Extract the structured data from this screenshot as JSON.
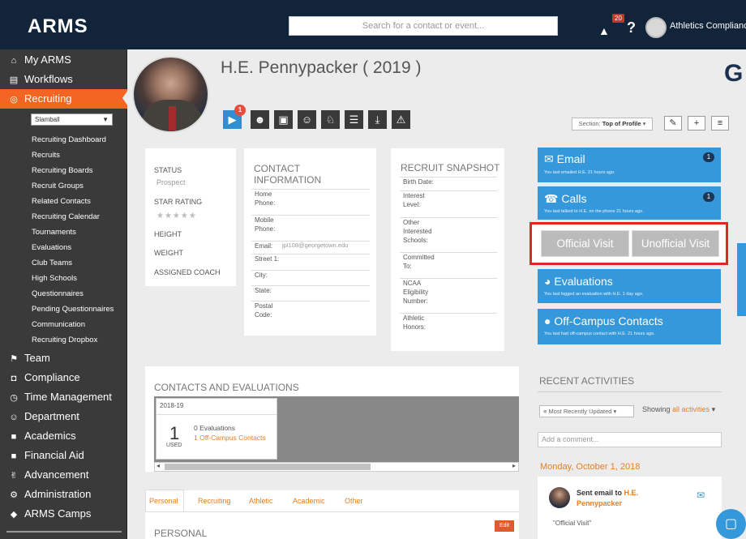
{
  "topbar": {
    "logo": "ARMS",
    "search_placeholder": "Search for a contact or event...",
    "notification_count": "20",
    "help": "?",
    "user_name": "Athletics Compliance"
  },
  "sidebar": {
    "items": [
      {
        "label": "My ARMS",
        "icon": "home-icon"
      },
      {
        "label": "Workflows",
        "icon": "clipboard-icon"
      },
      {
        "label": "Recruiting",
        "icon": "target-icon"
      },
      {
        "label": "Team",
        "icon": "flag-icon"
      },
      {
        "label": "Compliance",
        "icon": "shield-icon"
      },
      {
        "label": "Time Management",
        "icon": "clock-icon"
      },
      {
        "label": "Department",
        "icon": "group-icon"
      },
      {
        "label": "Academics",
        "icon": "book-icon"
      },
      {
        "label": "Financial Aid",
        "icon": "book-icon"
      },
      {
        "label": "Advancement",
        "icon": "handshake-icon"
      },
      {
        "label": "Administration",
        "icon": "gear-icon"
      },
      {
        "label": "ARMS Camps",
        "icon": "diamond-icon"
      }
    ],
    "sport_select": "Slamball",
    "subitems": [
      "Recruiting Dashboard",
      "Recruits",
      "Recruiting Boards",
      "Recruit Groups",
      "Related Contacts",
      "Recruiting Calendar",
      "Tournaments",
      "Evaluations",
      "Club Teams",
      "High Schools",
      "Questionnaires",
      "Pending Questionnaires",
      "Communication",
      "Recruiting Dropbox"
    ]
  },
  "profile": {
    "name": "H.E. Pennypacker ( 2019 )",
    "school_logo": "G",
    "icon_badge": "1",
    "action_icons": [
      "play-icon",
      "group-icon",
      "id-card-icon",
      "person-icon",
      "trophy-icon",
      "document-icon",
      "download-icon",
      "warning-icon"
    ],
    "section_label": "Section:",
    "section_value": "Top of Profile",
    "tool_buttons": [
      "edit-icon",
      "+",
      "≡"
    ]
  },
  "status_card": {
    "status_label": "STATUS",
    "status_value": "Prospect",
    "star_label": "STAR RATING",
    "stars": "★★★★★",
    "height_label": "HEIGHT",
    "weight_label": "WEIGHT",
    "coach_label": "ASSIGNED COACH"
  },
  "contact_info": {
    "title_1": "CONTACT",
    "title_2": "INFORMATION",
    "fields": [
      {
        "label_1": "Home",
        "label_2": "Phone:",
        "value": ""
      },
      {
        "label_1": "Mobile",
        "label_2": "Phone:",
        "value": ""
      },
      {
        "label_1": "Email:",
        "label_2": "",
        "value": "jpl108@georgetown.edu"
      },
      {
        "label_1": "Street 1:",
        "label_2": "",
        "value": ""
      },
      {
        "label_1": "City:",
        "label_2": "",
        "value": ""
      },
      {
        "label_1": "State:",
        "label_2": "",
        "value": ""
      },
      {
        "label_1": "Postal",
        "label_2": "Code:",
        "value": ""
      }
    ]
  },
  "snapshot": {
    "title": "RECRUIT SNAPSHOT",
    "fields": [
      "Birth Date:",
      "Interest\nLevel:",
      "Other\nInterested\nSchools:",
      "Committed\nTo:",
      "NCAA\nEligibility\nNumber:",
      "Athletic\nHonors:"
    ]
  },
  "comm_panels": {
    "email_title": "Email",
    "email_sub": "You last emailed H.E. 21 hours ago.",
    "email_count": "1",
    "calls_title": "Calls",
    "calls_sub": "You last talked to H.E. on the phone 21 hours ago.",
    "calls_count": "1",
    "official_visit": "Official Visit",
    "unofficial_visit": "Unofficial Visit",
    "evaluations_title": "Evaluations",
    "evaluations_sub": "You last logged an evaluation with H.E. 1 day ago.",
    "offcampus_title": "Off-Campus Contacts",
    "offcampus_sub": "You last had off-campus contact with H.E. 21 hours ago."
  },
  "contacts_evals": {
    "title": "CONTACTS AND EVALUATIONS",
    "year": "2018-19",
    "used_count": "1",
    "used_label": "USED",
    "evaluations": "0 Evaluations",
    "offcampus": "1 Off-Campus Contacts"
  },
  "tabs": {
    "items": [
      "Personal",
      "Recruiting",
      "Athletic",
      "Academic",
      "Other"
    ],
    "section_title": "PERSONAL",
    "edit_label": "Edit"
  },
  "recent": {
    "title": "RECENT ACTIVITIES",
    "sort": "Most Recently Updated",
    "showing_label": "Showing",
    "showing_value": "all activities",
    "comment_placeholder": "Add a comment...",
    "date": "Monday, October 1, 2018",
    "activity_title_1": "Sent email to",
    "activity_name_1": "H.E.",
    "activity_name_2": "Pennypacker",
    "activity_quote": "\"Official Visit\""
  },
  "colors": {
    "topbar": "#12243a",
    "sidebar": "#3a3a3a",
    "accent_orange": "#f26522",
    "panel_blue": "#3498db",
    "highlight_red": "#e22626"
  }
}
